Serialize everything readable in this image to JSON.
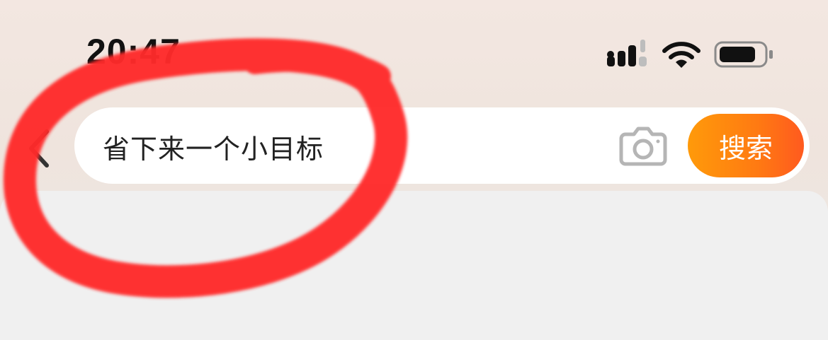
{
  "status_bar": {
    "time": "20:47",
    "icons": [
      "cellular-signal-icon",
      "wifi-icon",
      "battery-icon"
    ]
  },
  "search": {
    "query": "省下来一个小目标",
    "button_label": "搜索",
    "icons": [
      "back-chevron-icon",
      "camera-icon"
    ]
  },
  "colors": {
    "search_button_start": "#ff9a0a",
    "search_button_end": "#ff5a1f",
    "annotation_red": "#ff2b2b",
    "content_bg": "#f0f0f0"
  }
}
